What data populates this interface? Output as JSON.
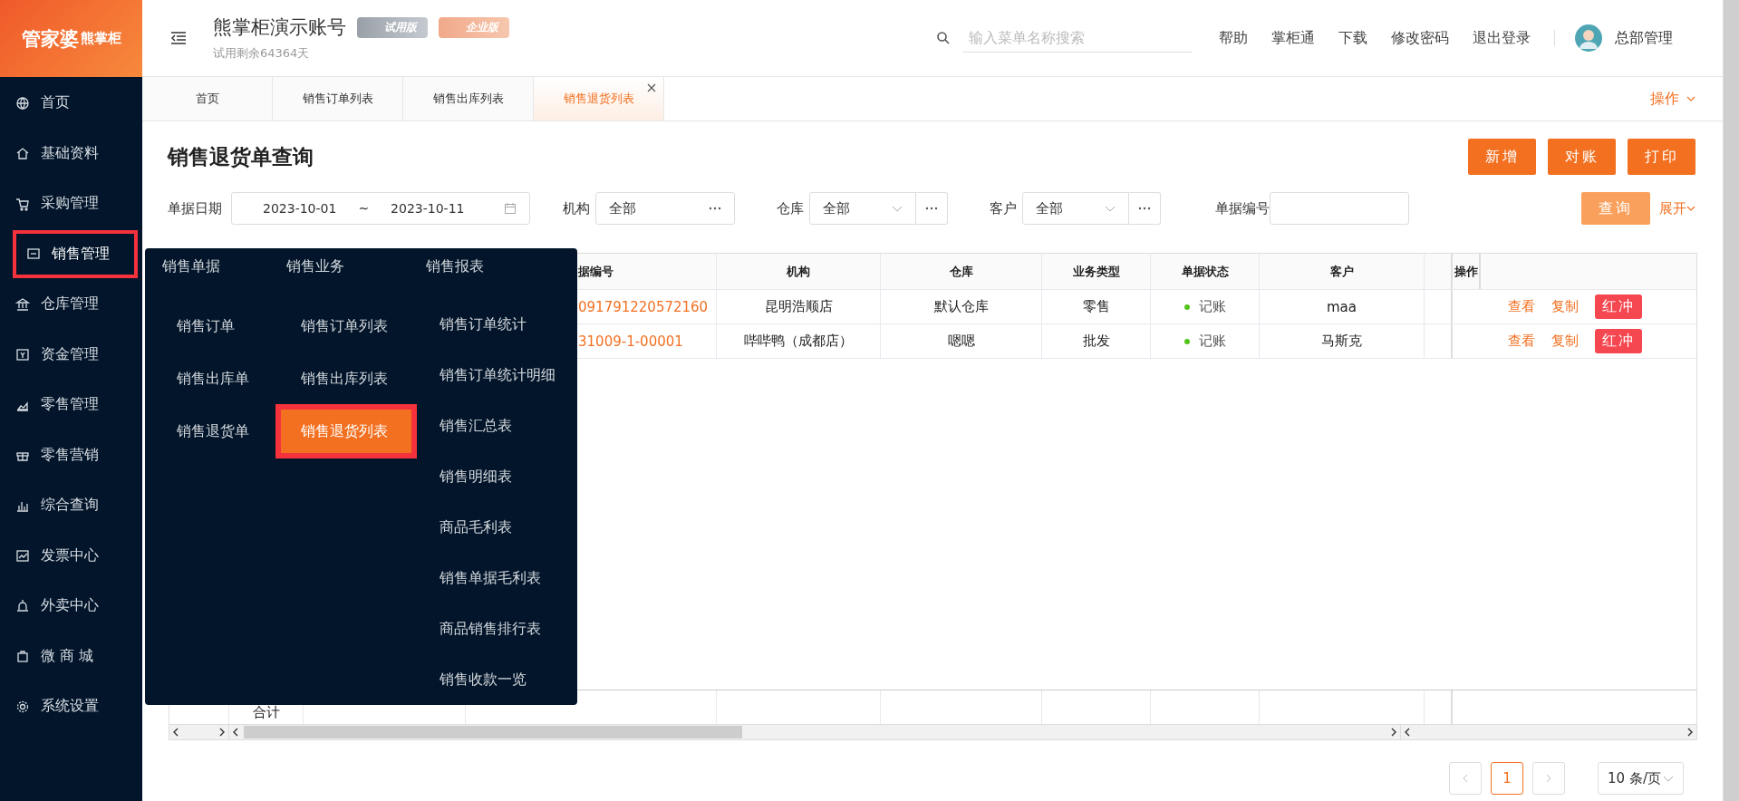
{
  "brand": {
    "logo": "管家婆",
    "logo_mark": "熊掌柜"
  },
  "header": {
    "account": "熊掌柜演示账号",
    "badges": [
      {
        "label": "试用版",
        "kind": "trial"
      },
      {
        "label": "企业版",
        "kind": "enterprise"
      }
    ],
    "trial_note": "试用剩余64364天",
    "search": {
      "placeholder": "输入菜单名称搜索"
    },
    "links": [
      "帮助",
      "掌柜通",
      "下载",
      "修改密码",
      "退出登录"
    ],
    "user": "总部管理"
  },
  "sidebar": {
    "items": [
      {
        "label": "首页",
        "selected": false
      },
      {
        "label": "基础资料",
        "selected": false
      },
      {
        "label": "采购管理",
        "selected": false
      },
      {
        "label": "销售管理",
        "selected": true
      },
      {
        "label": "仓库管理",
        "selected": false
      },
      {
        "label": "资金管理",
        "selected": false
      },
      {
        "label": "零售管理",
        "selected": false
      },
      {
        "label": "零售营销",
        "selected": false
      },
      {
        "label": "综合查询",
        "selected": false
      },
      {
        "label": "发票中心",
        "selected": false
      },
      {
        "label": "外卖中心",
        "selected": false
      },
      {
        "label": "微 商 城",
        "selected": false
      },
      {
        "label": "系统设置",
        "selected": false
      }
    ]
  },
  "tabs": [
    {
      "label": "首页",
      "selected": false
    },
    {
      "label": "销售订单列表",
      "selected": false
    },
    {
      "label": "销售出库列表",
      "selected": false
    },
    {
      "label": "销售退货列表",
      "selected": true
    }
  ],
  "tab_actions": "操作",
  "page": {
    "title": "销售退货单查询",
    "buttons": [
      "新增",
      "对账",
      "打印"
    ]
  },
  "filters": {
    "date_label": "单据日期",
    "date_from": "2023-10-01",
    "date_sep": "~",
    "date_to": "2023-10-11",
    "org": {
      "label": "机构",
      "value": "全部"
    },
    "warehouse": {
      "label": "仓库",
      "value": "全部"
    },
    "customer": {
      "label": "客户",
      "value": "全部"
    },
    "doc_no": {
      "label": "单据编号"
    },
    "query": "查询",
    "expand": "展开"
  },
  "table": {
    "columns": [
      "据编号",
      "机构",
      "仓库",
      "业务类型",
      "单据状态",
      "客户",
      "操作"
    ],
    "rows": [
      {
        "doc_no": "091791220572160",
        "org": "昆明浩顺店",
        "warehouse": "默认仓库",
        "type": "零售",
        "status": "记账",
        "customer": "maa",
        "actions": [
          "查看",
          "复制",
          "红冲"
        ]
      },
      {
        "doc_no": "31009-1-00001",
        "org": "哔哔鸭（成都店）",
        "warehouse": "嗯嗯",
        "type": "批发",
        "status": "记账",
        "customer": "马斯克",
        "actions": [
          "查看",
          "复制",
          "红冲"
        ]
      }
    ],
    "footer_label": "合计"
  },
  "flyout": {
    "columns": [
      {
        "heading": "销售单据",
        "items": [
          {
            "label": "销售订单",
            "selected": false
          },
          {
            "label": "销售出库单",
            "selected": false
          },
          {
            "label": "销售退货单",
            "selected": false
          }
        ]
      },
      {
        "heading": "销售业务",
        "items": [
          {
            "label": "销售订单列表",
            "selected": false
          },
          {
            "label": "销售出库列表",
            "selected": false
          },
          {
            "label": "销售退货列表",
            "selected": true
          }
        ]
      },
      {
        "heading": "销售报表",
        "items": [
          {
            "label": "销售订单统计",
            "selected": false
          },
          {
            "label": "销售订单统计明细",
            "selected": false
          },
          {
            "label": "销售汇总表",
            "selected": false
          },
          {
            "label": "销售明细表",
            "selected": false
          },
          {
            "label": "商品毛利表",
            "selected": false
          },
          {
            "label": "销售单据毛利表",
            "selected": false
          },
          {
            "label": "商品销售排行表",
            "selected": false
          },
          {
            "label": "销售收款一览",
            "selected": false
          }
        ]
      }
    ]
  },
  "pagination": {
    "pages": [
      {
        "label": "1",
        "selected": true
      }
    ],
    "page_size": "10 条/页"
  }
}
